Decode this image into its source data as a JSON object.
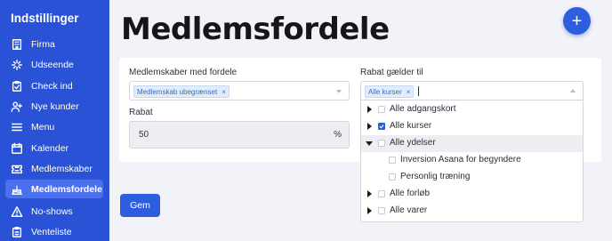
{
  "sidebar": {
    "title": "Indstillinger",
    "items": [
      {
        "label": "Firma",
        "icon": "building-icon"
      },
      {
        "label": "Udseende",
        "icon": "magic-icon"
      },
      {
        "label": "Check ind",
        "icon": "clipboard-check-icon"
      },
      {
        "label": "Nye kunder",
        "icon": "user-plus-icon"
      },
      {
        "label": "Menu",
        "icon": "menu-icon"
      },
      {
        "label": "Kalender",
        "icon": "calendar-icon"
      },
      {
        "label": "Medlemskaber",
        "icon": "ticket-icon"
      },
      {
        "label": "Medlemsfordele",
        "icon": "cake-icon",
        "active": true
      },
      {
        "label": "No-shows",
        "icon": "warning-icon"
      },
      {
        "label": "Venteliste",
        "icon": "clipboard-list-icon"
      }
    ]
  },
  "page": {
    "title": "Medlemsfordele",
    "add_button": "+"
  },
  "form": {
    "memberships": {
      "label": "Medlemskaber med fordele",
      "tag": "Medlemskab ubegrænset",
      "tag_remove": "×"
    },
    "discount": {
      "label": "Rabat",
      "value": "50",
      "unit": "%"
    },
    "applies_to": {
      "label": "Rabat gælder til",
      "tag": "Alle kurser",
      "tag_remove": "×"
    },
    "options": [
      {
        "label": "Alle adgangskort",
        "expander": "collapsed",
        "checked": false,
        "level": 0
      },
      {
        "label": "Alle kurser",
        "expander": "collapsed",
        "checked": true,
        "level": 0
      },
      {
        "label": "Alle ydelser",
        "expander": "expanded",
        "checked": false,
        "level": 0,
        "highlighted": true
      },
      {
        "label": "Inversion Asana for begyndere",
        "expander": "none",
        "checked": false,
        "level": 1
      },
      {
        "label": "Personlig træning",
        "expander": "none",
        "checked": false,
        "level": 1
      },
      {
        "label": "Alle forløb",
        "expander": "collapsed",
        "checked": false,
        "level": 0
      },
      {
        "label": "Alle varer",
        "expander": "collapsed",
        "checked": false,
        "level": 0
      }
    ],
    "save_label": "Gem"
  },
  "colors": {
    "sidebar_bg": "#2a52d6",
    "sidebar_active": "#4a70ee",
    "primary": "#2e5de0",
    "page_bg": "#f1f3f8"
  }
}
